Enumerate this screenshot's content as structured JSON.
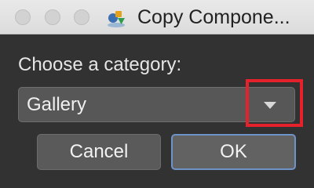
{
  "window": {
    "title": "Copy Compone...",
    "controls": [
      "close",
      "minimize",
      "zoom"
    ],
    "app_icon": "app-icon"
  },
  "dialog": {
    "prompt": "Choose a category:",
    "category_select": {
      "selected": "Gallery",
      "chevron_icon": "chevron-down-icon"
    },
    "highlight_color": "#e5212b"
  },
  "buttons": {
    "cancel_label": "Cancel",
    "ok_label": "OK"
  },
  "colors": {
    "background": "#323232",
    "focus_ring": "#6f92c8"
  }
}
